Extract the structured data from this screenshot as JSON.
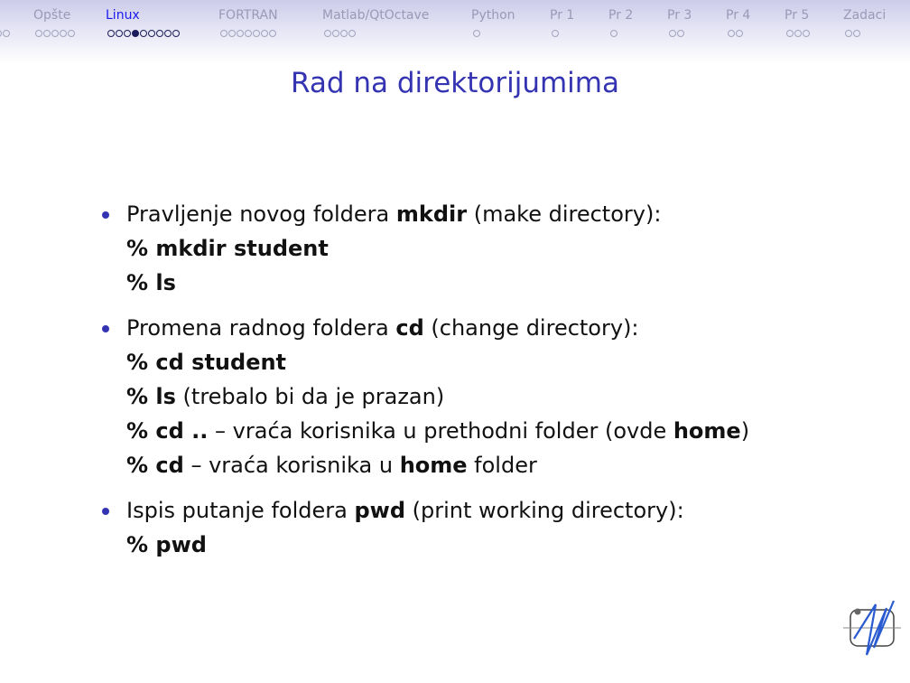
{
  "nav": {
    "sections": [
      {
        "label": "Opšte",
        "dots": 5,
        "active": false,
        "current": -1
      },
      {
        "label": "Linux",
        "dots": 9,
        "active": true,
        "current": 3
      },
      {
        "label": "FORTRAN",
        "dots": 7,
        "active": false,
        "current": -1
      },
      {
        "label": "Matlab/QtOctave",
        "dots": 4,
        "active": false,
        "current": -1
      },
      {
        "label": "Python",
        "dots": 1,
        "active": false,
        "current": -1
      },
      {
        "label": "Pr 1",
        "dots": 1,
        "active": false,
        "current": -1
      },
      {
        "label": "Pr 2",
        "dots": 1,
        "active": false,
        "current": -1
      },
      {
        "label": "Pr 3",
        "dots": 2,
        "active": false,
        "current": -1
      },
      {
        "label": "Pr 4",
        "dots": 2,
        "active": false,
        "current": -1
      },
      {
        "label": "Pr 5",
        "dots": 3,
        "active": false,
        "current": -1
      },
      {
        "label": "Zadaci",
        "dots": 2,
        "active": false,
        "current": -1
      }
    ]
  },
  "slide": {
    "title": "Rad na direktorijumima",
    "items": [
      {
        "lines": [
          [
            {
              "t": "Pravljenje novog foldera ",
              "b": false
            },
            {
              "t": "mkdir",
              "b": true
            },
            {
              "t": " (make directory):",
              "b": false
            }
          ],
          [
            {
              "t": "% mkdir student",
              "b": true
            }
          ],
          [
            {
              "t": "% ls",
              "b": true
            }
          ]
        ]
      },
      {
        "lines": [
          [
            {
              "t": "Promena radnog foldera ",
              "b": false
            },
            {
              "t": "cd",
              "b": true
            },
            {
              "t": " (change directory):",
              "b": false
            }
          ],
          [
            {
              "t": "% cd student",
              "b": true
            }
          ],
          [
            {
              "t": "% ls",
              "b": true
            },
            {
              "t": " (trebalo bi da je prazan)",
              "b": false
            }
          ],
          [
            {
              "t": "% cd ..",
              "b": true
            },
            {
              "t": " – vraća korisnika u prethodni folder (ovde ",
              "b": false
            },
            {
              "t": "home",
              "b": true
            },
            {
              "t": ")",
              "b": false
            }
          ],
          [
            {
              "t": "% cd",
              "b": true
            },
            {
              "t": " – vraća korisnika u ",
              "b": false
            },
            {
              "t": "home",
              "b": true
            },
            {
              "t": " folder",
              "b": false
            }
          ]
        ]
      },
      {
        "lines": [
          [
            {
              "t": "Ispis putanje foldera ",
              "b": false
            },
            {
              "t": "pwd",
              "b": true
            },
            {
              "t": " (print working directory):",
              "b": false
            }
          ],
          [
            {
              "t": "% pwd",
              "b": true
            }
          ]
        ]
      }
    ]
  },
  "colors": {
    "accent": "#3434b2",
    "nav_active": "#1a1aee",
    "nav_inactive": "#9a9ab8"
  }
}
